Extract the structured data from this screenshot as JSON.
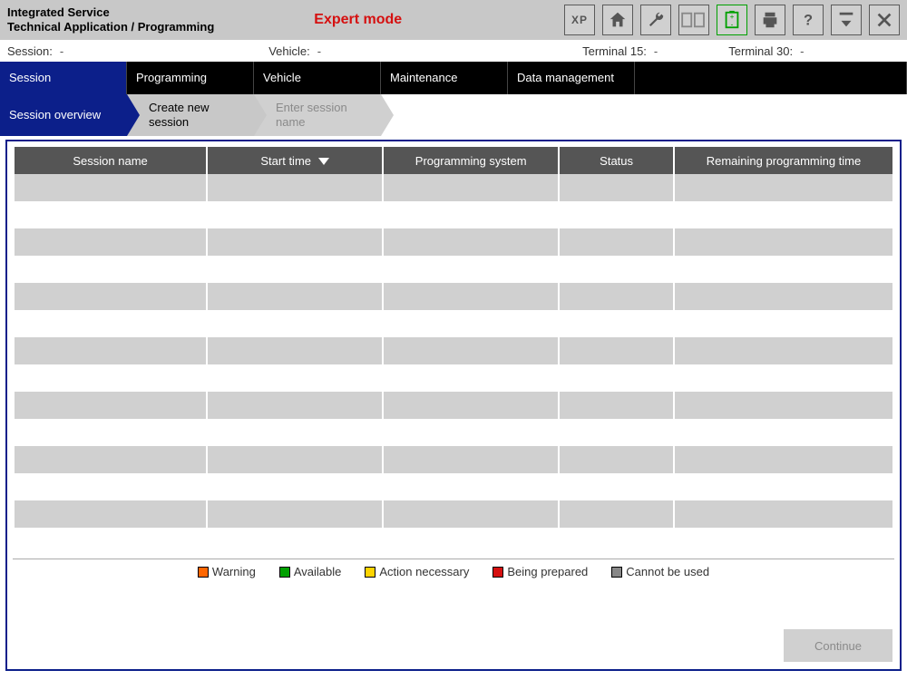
{
  "header": {
    "title_line1": "Integrated Service",
    "title_line2": "Technical Application / Programming",
    "mode": "Expert mode"
  },
  "toolbar": {
    "xp": "XP"
  },
  "status": {
    "session_label": "Session:",
    "session_value": "-",
    "vehicle_label": "Vehicle:",
    "vehicle_value": "-",
    "t15_label": "Terminal 15:",
    "t15_value": "-",
    "t30_label": "Terminal 30:",
    "t30_value": "-"
  },
  "nav": {
    "session": "Session",
    "programming": "Programming",
    "vehicle": "Vehicle",
    "maintenance": "Maintenance",
    "data_mgmt": "Data management"
  },
  "bc": {
    "overview": "Session overview",
    "create": "Create new session",
    "enter_name": "Enter session name"
  },
  "table": {
    "headers": {
      "name": "Session name",
      "start": "Start time",
      "psys": "Programming system",
      "status": "Status",
      "remaining": "Remaining programming time"
    }
  },
  "legend": {
    "warning": "Warning",
    "available": "Available",
    "action": "Action necessary",
    "prepared": "Being prepared",
    "cannot": "Cannot be used"
  },
  "footer": {
    "continue": "Continue"
  }
}
